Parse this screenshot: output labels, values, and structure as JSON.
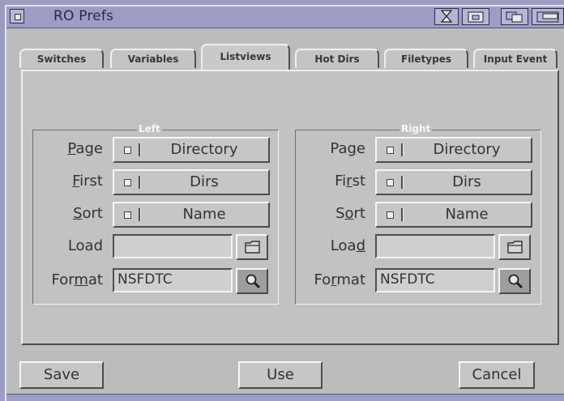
{
  "window": {
    "title": "RO Prefs"
  },
  "tabs": [
    "Switches",
    "Variables",
    "Listviews",
    "Hot Dirs",
    "Filetypes",
    "Input Event"
  ],
  "active_tab": "Listviews",
  "left": {
    "title": "Left",
    "page_label": "Page",
    "page_value": "Directory",
    "first_label": "First",
    "first_value": "Dirs",
    "sort_label": "Sort",
    "sort_value": "Name",
    "load_label": "Load",
    "load_value": "",
    "format_label": "Format",
    "format_value": "NSFDTC"
  },
  "right": {
    "title": "Right",
    "page_label": "Page",
    "page_value": "Directory",
    "first_label": "First",
    "first_value": "Dirs",
    "sort_label": "Sort",
    "sort_value": "Name",
    "load_label": "Load",
    "load_value": "",
    "format_label": "Format",
    "format_value": "NSFDTC"
  },
  "buttons": {
    "save": "Save",
    "use": "Use",
    "cancel": "Cancel"
  },
  "icons": {
    "close": "close-gadget-icon",
    "depth": "depth-gadget-icon",
    "zoom": "zoom-gadget-icon",
    "iconify": "iconify-gadget-icon",
    "folder": "folder-icon",
    "magnify": "magnifier-icon"
  },
  "colors": {
    "titlebar": "#9c9cc4",
    "window_bg": "#bcbcbc",
    "panel": "#c2c2c2",
    "desktop": "#9c9cc2"
  }
}
